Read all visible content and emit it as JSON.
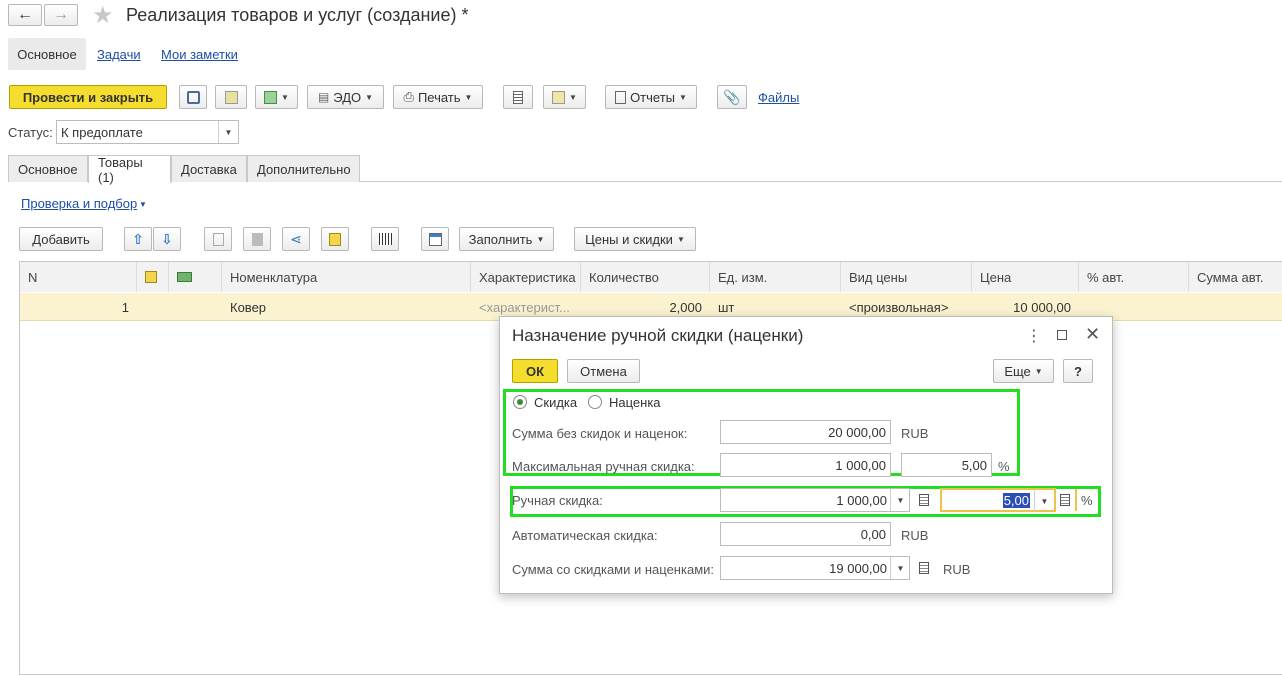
{
  "window": {
    "title": "Реализация товаров и услуг (создание) *"
  },
  "nav_links": {
    "main": "Основное",
    "tasks": "Задачи",
    "notes": "Мои заметки"
  },
  "toolbar": {
    "post_close": "Провести и закрыть",
    "edo": "ЭДО",
    "print": "Печать",
    "reports": "Отчеты",
    "files": "Файлы"
  },
  "status": {
    "label": "Статус:",
    "value": "К предоплате"
  },
  "tabs": [
    {
      "label": "Основное"
    },
    {
      "label": "Товары (1)"
    },
    {
      "label": "Доставка"
    },
    {
      "label": "Дополнительно"
    }
  ],
  "goods": {
    "check_link": "Проверка и подбор",
    "add_button": "Добавить",
    "fill_button": "Заполнить",
    "prices_button": "Цены и скидки",
    "columns": [
      "N",
      "Номенклатура",
      "Характеристика",
      "Количество",
      "Ед. изм.",
      "Вид цены",
      "Цена",
      "% авт.",
      "Сумма авт."
    ],
    "rows": [
      {
        "n": "1",
        "item": "Ковер",
        "characteristic": "<характерист...",
        "quantity": "2,000",
        "unit": "шт",
        "price_type": "<произвольная>",
        "price": "10 000,00"
      }
    ]
  },
  "dialog": {
    "title": "Назначение ручной скидки (наценки)",
    "ok": "ОК",
    "cancel": "Отмена",
    "more": "Еще",
    "help": "?",
    "radio_discount": "Скидка",
    "radio_markup": "Наценка",
    "sum_without_label": "Сумма без скидок и наценок:",
    "sum_without_value": "20 000,00",
    "max_manual_label": "Максимальная ручная скидка:",
    "max_manual_value": "1 000,00",
    "max_manual_pct": "5,00",
    "manual_label": "Ручная скидка:",
    "manual_value": "1 000,00",
    "manual_pct": "5,00",
    "auto_label": "Автоматическая скидка:",
    "auto_value": "0,00",
    "total_label": "Сумма со скидками и наценками:",
    "total_value": "19 000,00",
    "currency": "RUB",
    "percent": "%"
  },
  "colors": {
    "accent_yellow": "#f5dd2e",
    "highlight_green": "#22dd22",
    "row_highlight": "#fbf3d0",
    "link_blue": "#1d4fa5"
  }
}
